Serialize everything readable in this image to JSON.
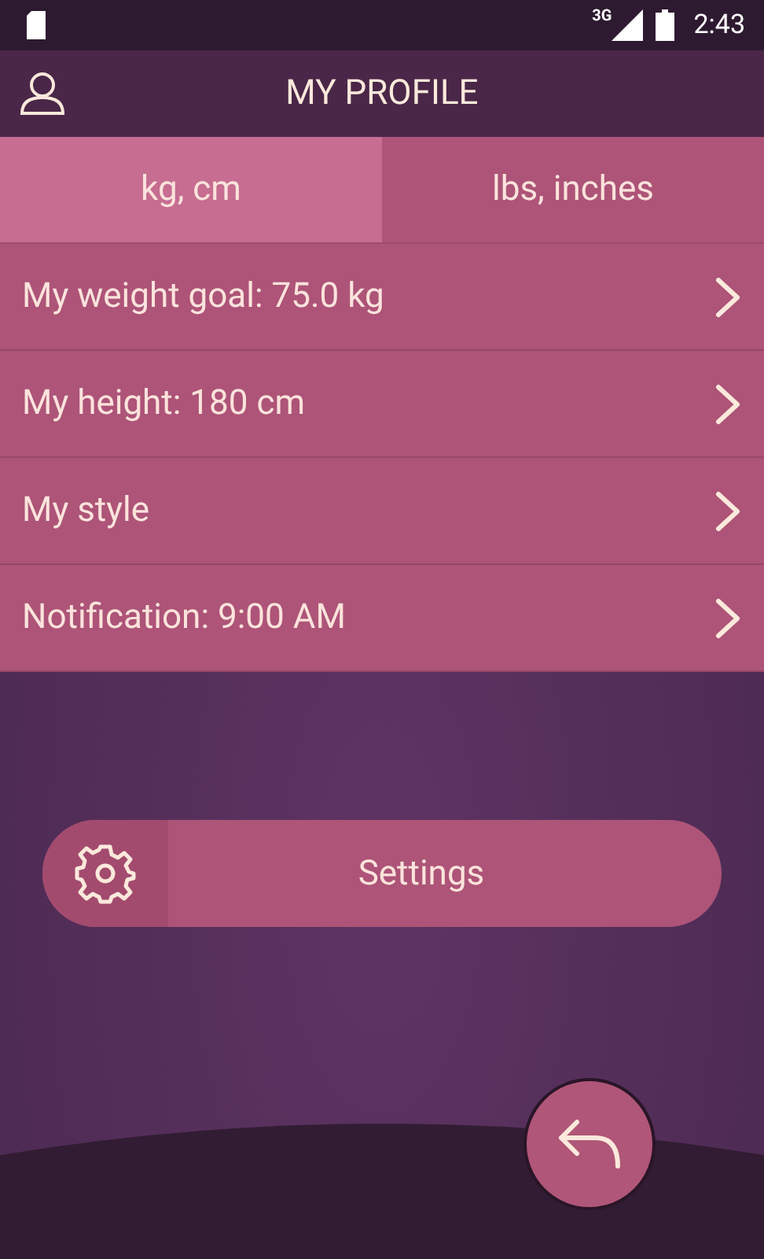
{
  "status_bar": {
    "network": "3G",
    "time": "2:43"
  },
  "header": {
    "title": "MY PROFILE"
  },
  "tabs": [
    {
      "label": "kg, cm",
      "selected": true
    },
    {
      "label": "lbs, inches",
      "selected": false
    }
  ],
  "items": [
    {
      "label": "My weight goal: 75.0 kg"
    },
    {
      "label": "My height: 180 cm"
    },
    {
      "label": "My style"
    },
    {
      "label": "Notification: 9:00 AM"
    }
  ],
  "settings_button": {
    "label": "Settings"
  }
}
